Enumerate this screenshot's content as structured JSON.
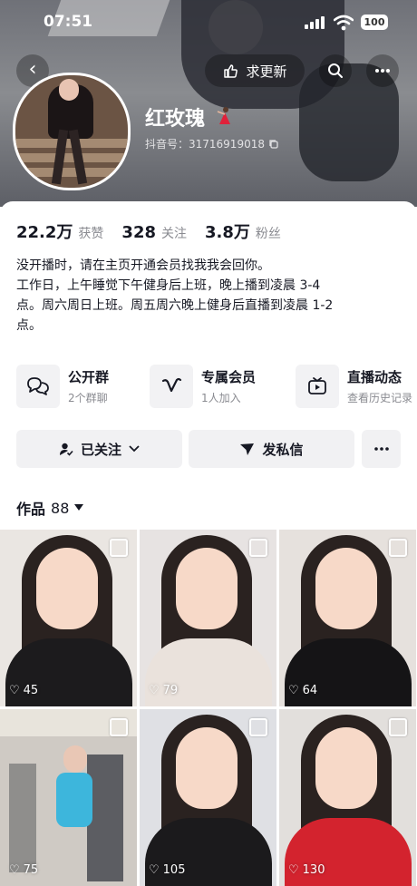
{
  "status_bar": {
    "time": "07:51",
    "battery": "100"
  },
  "header": {
    "update_button": "求更新",
    "name": "红玫瑰",
    "douyin_id": "抖音号：31716919018"
  },
  "stats": [
    {
      "value": "22.2万",
      "label": "获赞"
    },
    {
      "value": "328",
      "label": "关注"
    },
    {
      "value": "3.8万",
      "label": "粉丝"
    }
  ],
  "bio": [
    "没开播时，请在主页开通会员找我我会回你。",
    "工作日，上午睡觉下午健身后上班，晚上播到凌晨 3-4",
    "点。周六周日上班。周五周六晚上健身后直播到凌晨 1-2",
    "点。"
  ],
  "features": [
    {
      "title": "公开群",
      "subtitle": "2个群聊",
      "icon": "group-chat-icon"
    },
    {
      "title": "专属会员",
      "subtitle": "1人加入",
      "icon": "membership-v-icon"
    },
    {
      "title": "直播动态",
      "subtitle": "查看历史记录",
      "icon": "live-tv-icon"
    }
  ],
  "actions": {
    "followed": "已关注",
    "message": "发私信"
  },
  "works": {
    "label": "作品",
    "count": "88"
  },
  "videos": [
    {
      "likes": "45"
    },
    {
      "likes": "79"
    },
    {
      "likes": "64"
    },
    {
      "likes": "75"
    },
    {
      "likes": "105"
    },
    {
      "likes": "130"
    }
  ],
  "colors": {
    "text": "#161823",
    "muted": "#8a8b91",
    "button_bg": "#f1f1f3"
  }
}
